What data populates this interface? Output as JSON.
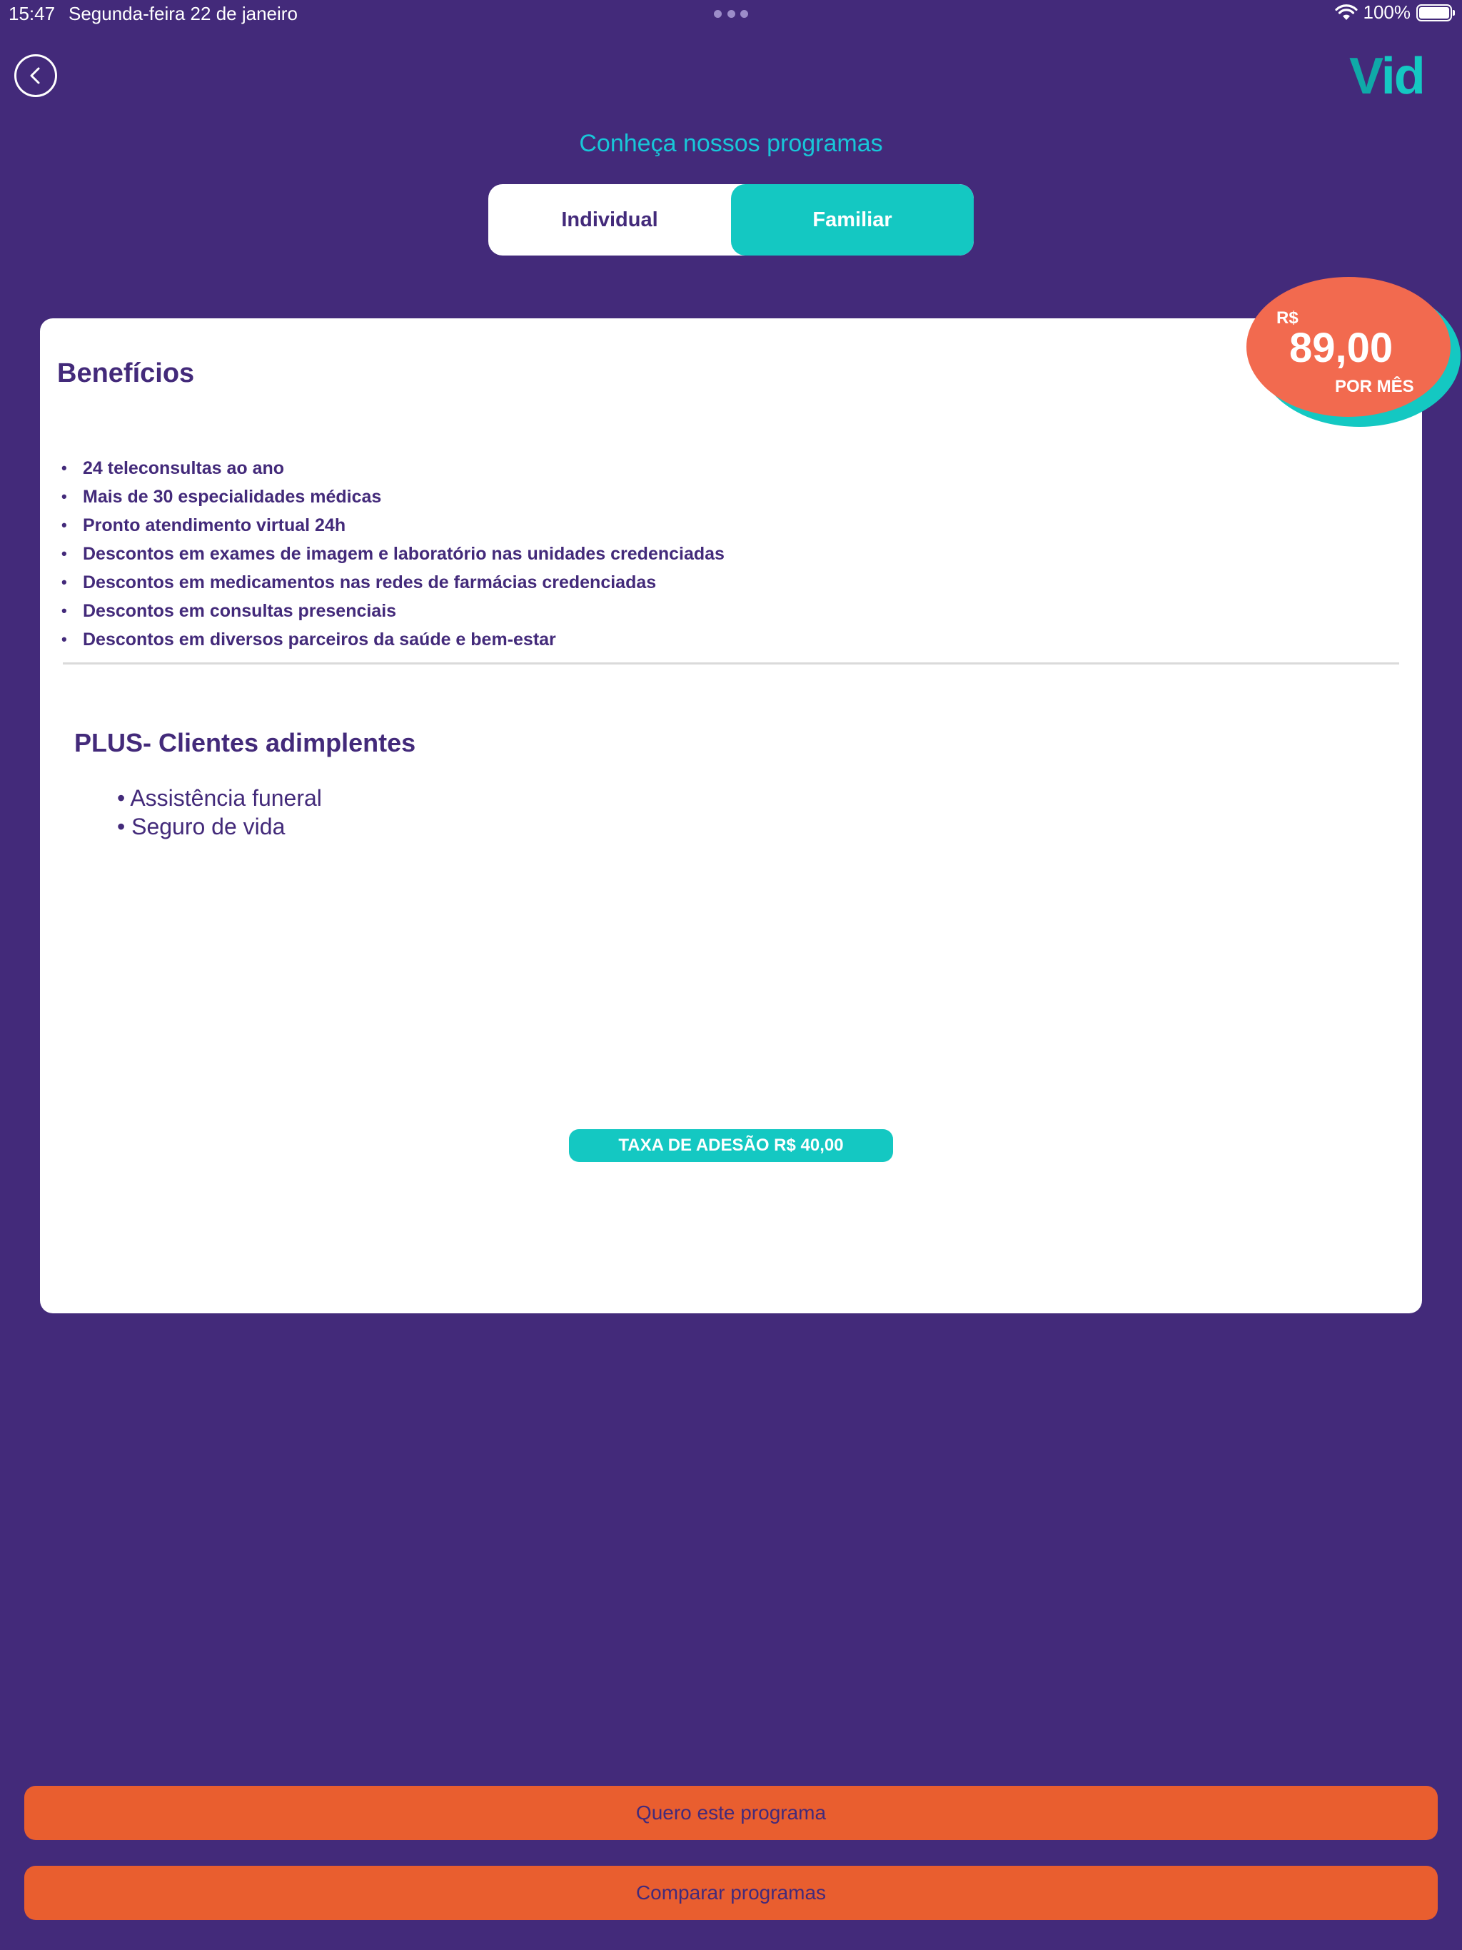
{
  "status_bar": {
    "time": "15:47",
    "date": "Segunda-feira 22 de janeiro",
    "battery": "100%",
    "battery_level": 1.0
  },
  "header": {
    "logo_v": "V",
    "logo_rest": "id",
    "title": "Conheça nossos programas"
  },
  "toggle": {
    "options": [
      "Individual",
      "Familiar"
    ],
    "selected": "Familiar"
  },
  "price": {
    "currency": "R$",
    "value": "89,00",
    "period": "POR MÊS"
  },
  "benefits": {
    "title": "Benefícios",
    "items": [
      "24 teleconsultas ao ano",
      "Mais de 30 especialidades médicas",
      "Pronto atendimento virtual 24h",
      "Descontos em exames de imagem e laboratório nas unidades credenciadas",
      "Descontos em medicamentos nas redes de farmácias credenciadas",
      "Descontos em consultas presenciais",
      "Descontos em diversos parceiros da saúde e bem-estar"
    ]
  },
  "plus": {
    "title": "PLUS- Clientes adimplentes",
    "items": [
      "Assistência funeral",
      "Seguro de vida"
    ]
  },
  "fee": "TAXA DE ADESÃO R$ 40,00",
  "actions": {
    "want": "Quero este programa",
    "compare": "Comparar programas"
  },
  "colors": {
    "background": "#432A7A",
    "accent_teal": "#14C8C2",
    "accent_orange": "#E95E2F",
    "price_orange": "#F26A4F"
  },
  "icons": [
    "back-chevron-icon",
    "wifi-icon",
    "battery-icon"
  ]
}
